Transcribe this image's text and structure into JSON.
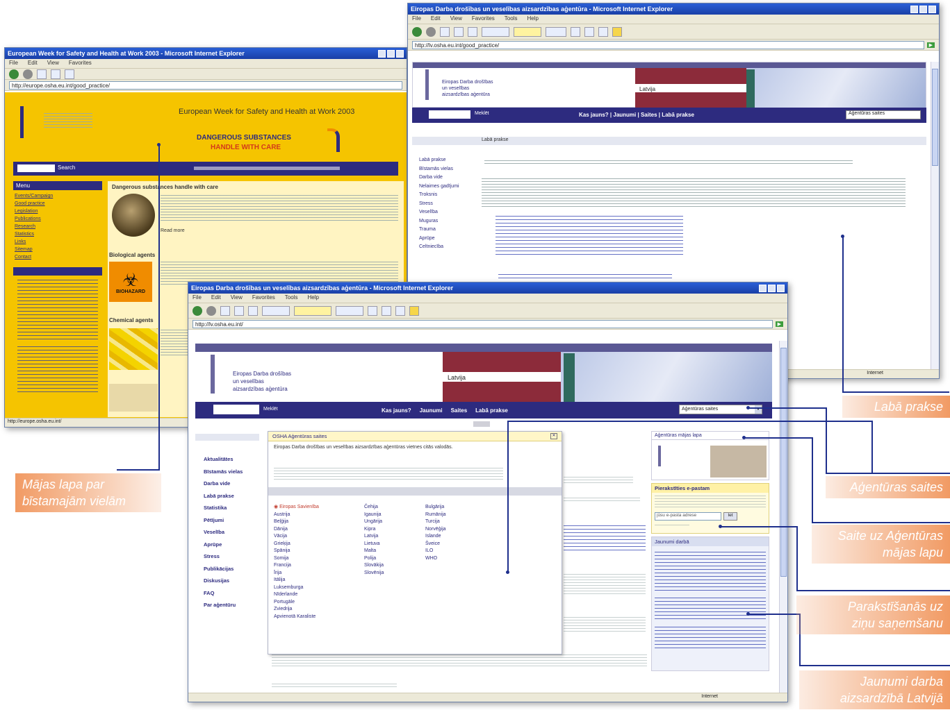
{
  "window_back_left": {
    "title": "European Week for Safety and Health at Work 2003 - Microsoft Internet Explorer",
    "address": "http://europe.osha.eu.int/good_practice/",
    "banner_title": "European Week for Safety and Health at Work 2003",
    "banner_sub1": "DANGEROUS SUBSTANCES",
    "banner_sub2": "HANDLE WITH CARE",
    "search_btn": "Search",
    "nav_header": "Menu",
    "article_title": "Dangerous substances handle with care",
    "section2_title": "Biological agents",
    "section3_title": "Chemical agents",
    "biohazard_label": "BIOHAZARD",
    "nav_items": [
      "Events/Campaign",
      "Good practice",
      "Legislation",
      "Publications",
      "Research",
      "Statistics",
      "Links",
      "Sitemap",
      "Contact"
    ],
    "read_more": "Read more",
    "status": "http://europe.osha.eu.int/"
  },
  "window_back_right": {
    "title": "Eiropas Darba drošības un veselības aizsardzības aģentūra - Microsoft Internet Explorer",
    "address": "http://lv.osha.eu.int/good_practice/",
    "menu": [
      "File",
      "Edit",
      "View",
      "Favorites",
      "Tools",
      "Help"
    ],
    "agency_name": [
      "Eiropas Darba drošības",
      "un veselības",
      "aizsardzības aģentūra"
    ],
    "country": "Latvija",
    "search_btn": "Meklēt",
    "topnav": "Kas jauns? | Jaunumi | Saites | Labā prakse",
    "agency_sites": "Aģentūras saites",
    "breadcrumb": "Labā prakse",
    "left_nav": [
      "Labā prakse",
      "Bīstamās vielas",
      "Darba vide",
      "Nelaimes gadījumi",
      "Troksnis",
      "Stress",
      "Veselība",
      "Muguras",
      "Trauma",
      "Aprūpe",
      "Celtniecība"
    ],
    "status": "Internet"
  },
  "window_front": {
    "title": "Eiropas Darba drošības un veselības aizsardzības aģentūra - Microsoft Internet Explorer",
    "address": "http://lv.osha.eu.int/",
    "menu": [
      "File",
      "Edit",
      "View",
      "Favorites",
      "Tools",
      "Help"
    ],
    "search_label": "Meklēt",
    "agency_name": [
      "Eiropas Darba drošības",
      "un veselības",
      "aizsardzības aģentūra"
    ],
    "country": "Latvija",
    "topnav": [
      "Kas jauns?",
      "Jaunumi",
      "Saites",
      "Labā prakse"
    ],
    "sites_dropdown": "Aģentūras saites",
    "popup_title": "OSHA Aģentūras saites",
    "popup_intro": "Eiropas Darba drošības un veselības aizsardzības aģentūras vietnes citās valodās.",
    "popup_links_col1": [
      "Eiropas Savienība",
      "Austrija",
      "Beļģija",
      "Dānija",
      "Vācija",
      "Grieķija",
      "Spānija",
      "Somija",
      "Francija",
      "Īrija",
      "Itālija",
      "Luksemburga",
      "Nīderlande",
      "Portugāle",
      "Zviedrija",
      "Apvienotā Karaliste"
    ],
    "popup_links_col2": [
      "Čehija",
      "Igaunija",
      "Ungārija",
      "Kipra",
      "Latvija",
      "Lietuva",
      "Malta",
      "Polija",
      "Slovākija",
      "Slovēnija"
    ],
    "popup_links_col3": [
      "Bulgārija",
      "Rumānija",
      "Turcija",
      "Norvēģija",
      "Islande",
      "Šveice",
      "ILO",
      "WHO"
    ],
    "left_nav": [
      "Aktualitātes",
      "Bīstamās vielas",
      "Darba vide",
      "Labā prakse",
      "Statistika",
      "Pētījumi",
      "Veselība",
      "Aprūpe",
      "Stress",
      "Publikācijas",
      "Diskusijas",
      "FAQ",
      "Par aģentūru"
    ],
    "right_box1_title": "Aģentūras mājas lapa",
    "right_box2_title": "Pierakstīties e-pastam",
    "right_box2_btn": "Iet",
    "right_box2_input": "jūsu e-pasta adrese",
    "right_box3_title": "Jaunumi darbā",
    "status": "Internet"
  },
  "callouts": {
    "laba_prakse": "Labā prakse",
    "agenturas_saites": "Aģentūras saites",
    "saite_majas_line1": "Saite uz Aģentūras",
    "saite_majas_line2": "mājas lapu",
    "parakstisanas_line1": "Parakstīšanās uz",
    "parakstisanas_line2": "ziņu saņemšanu",
    "jaunumi_line1": "Jaunumi darba",
    "jaunumi_line2": "aizsardzībā Latvijā",
    "majas_lapa_line1": "Mājas lapa par",
    "majas_lapa_line2": "bīstamajām vielām"
  },
  "colors": {
    "callout": "#f19a63",
    "osha_blue": "#2d2b7f",
    "osha_yellow": "#f5c400",
    "line": "#1e2f8c"
  }
}
